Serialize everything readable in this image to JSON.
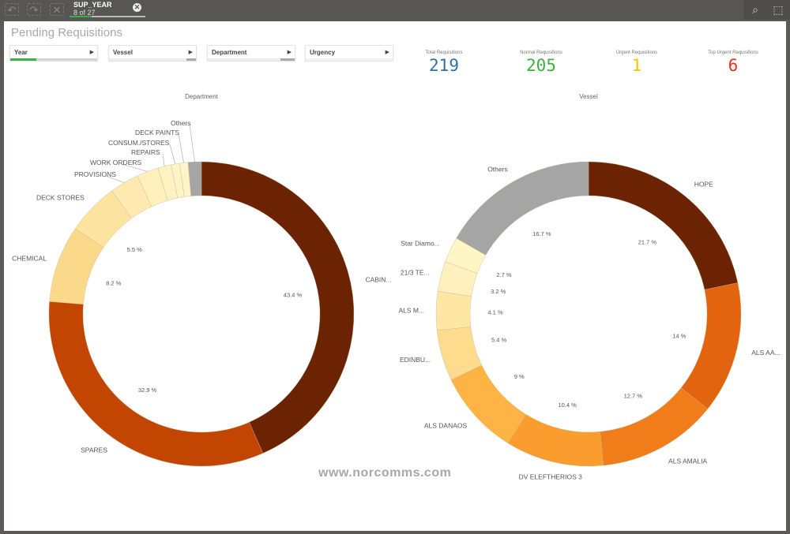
{
  "toolbar": {
    "selection_field": "SUP_YEAR",
    "selection_count": "8 of 27",
    "icons": [
      "step-back-icon",
      "step-forward-icon",
      "clear-selections-icon",
      "search-icon",
      "selection-tool-icon"
    ]
  },
  "sheet": {
    "title": "Pending Requisitions"
  },
  "filters": [
    {
      "label": "Year"
    },
    {
      "label": "Vessel"
    },
    {
      "label": "Department"
    },
    {
      "label": "Urgency"
    }
  ],
  "kpis": [
    {
      "label": "Total Requisitions",
      "value": "219",
      "color": "#2f6ea8"
    },
    {
      "label": "Normal Requisitions",
      "value": "205",
      "color": "#3db13d"
    },
    {
      "label": "Urgent Requisitions",
      "value": "1",
      "color": "#f5c400"
    },
    {
      "label": "Top Urgent Requisitions",
      "value": "6",
      "color": "#e5341d"
    }
  ],
  "watermark": "www.norcomms.com",
  "chart_data": [
    {
      "type": "pie",
      "donut": true,
      "title": "Department",
      "categories": [
        "CABIN...",
        "SPARES",
        "CHEMICAL",
        "DECK STORES",
        "PROVISIONS",
        "WORK ORDERS",
        "REPAIRS",
        "CONSUM./STORES",
        "DECK PAINTS",
        "Others"
      ],
      "values": [
        43.4,
        32.9,
        8.2,
        5.5,
        3.1,
        2.3,
        1.4,
        0.9,
        0.9,
        1.4
      ],
      "value_labels": [
        "43.4 %",
        "32.9 %",
        "8.2 %",
        "5.5 %",
        "",
        "",
        "",
        "",
        "",
        ""
      ],
      "colors": [
        "#6b2303",
        "#c24502",
        "#fbd98a",
        "#fde3a0",
        "#feeab0",
        "#fff0bc",
        "#fff2c2",
        "#fff3c4",
        "#fff4c8",
        "#a5a5a5"
      ]
    },
    {
      "type": "pie",
      "donut": true,
      "title": "Vessel",
      "categories": [
        "HOPE",
        "ALS AA...",
        "ALS AMALIA",
        "DV ELEFTHERIOS 3",
        "ALS DANAOS",
        "EDINBU...",
        "ALS M...",
        "21/3 TE...",
        "Star Diamo...",
        "Others"
      ],
      "values": [
        21.7,
        14,
        12.7,
        10.4,
        9,
        5.4,
        4.1,
        3.2,
        2.7,
        16.7
      ],
      "value_labels": [
        "21.7 %",
        "14 %",
        "12.7 %",
        "10.4 %",
        "9 %",
        "5.4 %",
        "4.1 %",
        "3.2 %",
        "2.7 %",
        "16.7 %"
      ],
      "colors": [
        "#6b2303",
        "#e3640f",
        "#f07d1a",
        "#fa9c2e",
        "#fdb444",
        "#fedb8d",
        "#fee6a5",
        "#fff0bd",
        "#fff5c5",
        "#a5a5a5"
      ]
    }
  ]
}
